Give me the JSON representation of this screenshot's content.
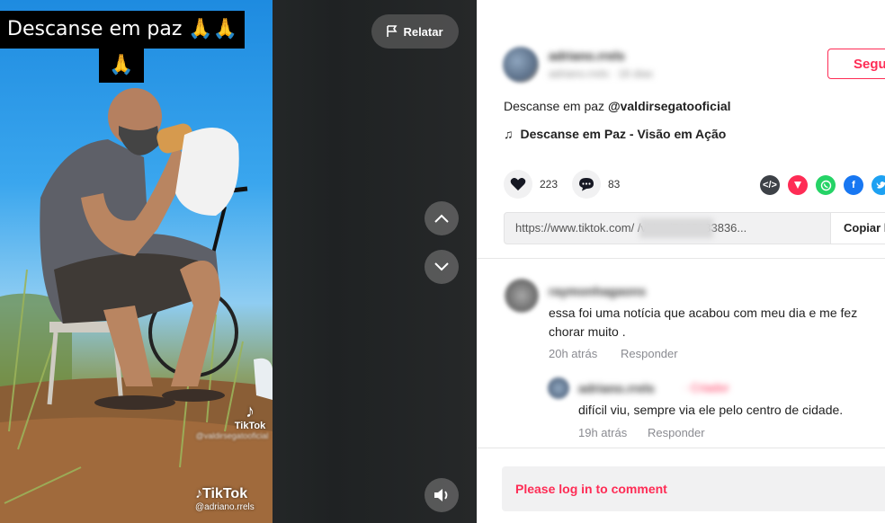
{
  "video": {
    "caption_line1": "Descanse em paz 🙏🙏",
    "caption_line2": "🙏",
    "watermark_small_logo": "TikTok",
    "watermark_small_user": "@valdirsegatooficial",
    "watermark_large_logo": "TikTok",
    "watermark_large_user": "@adriano.rrels",
    "report_label": "Relatar"
  },
  "author": {
    "name": "adriano.rrels",
    "subtitle": "adriano.rrels · 16 dias"
  },
  "follow_label": "Segu",
  "description": {
    "text": "Descanse em paz ",
    "mention": "@valdirsegatooficial"
  },
  "music": {
    "note_icon": "music-note-icon",
    "title": "Descanse em Paz - Visão em Ação"
  },
  "actions": {
    "likes": "223",
    "comments": "83"
  },
  "link": {
    "text": "https://www.tiktok.com/                              /video/7125333836...",
    "copy_label": "Copiar l"
  },
  "comments": [
    {
      "user": "raymonhagaons",
      "text": "essa foi uma notícia que acabou com meu dia e me fez chorar muito .",
      "time": "20h atrás",
      "reply_label": "Responder"
    },
    {
      "user": "adriano.rrels",
      "badge": "· Criador",
      "text": "difícil viu, sempre via ele pelo centro de cidade.",
      "time": "19h atrás",
      "reply_label": "Responder"
    }
  ],
  "login_prompt": "Please log in to comment",
  "colors": {
    "brand": "#fe2c55",
    "whatsapp": "#25d366",
    "facebook": "#1877f2",
    "twitter": "#1da1f2"
  }
}
